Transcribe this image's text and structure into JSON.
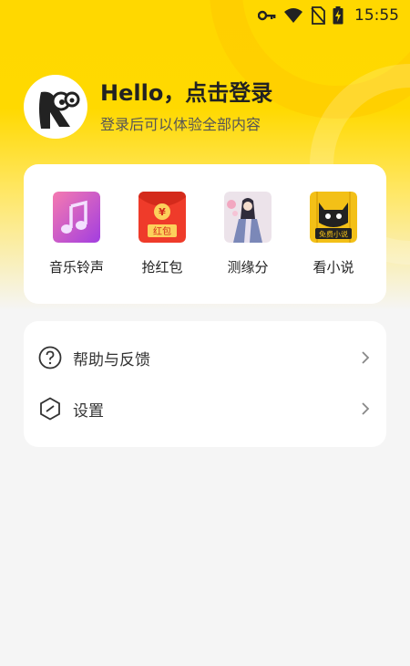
{
  "status_bar": {
    "time": "15:55",
    "icons": [
      "key-icon",
      "wifi-icon",
      "no-sim-icon",
      "battery-charging-icon"
    ]
  },
  "profile": {
    "avatar_icon": "cartoon-mascot-avatar",
    "title": "Hello，点击登录",
    "subtitle": "登录后可以体验全部内容"
  },
  "features": [
    {
      "label": "音乐铃声",
      "icon": "music-note-icon",
      "color": "#c24bd6"
    },
    {
      "label": "抢红包",
      "icon": "red-envelope-icon",
      "color": "#e53b24",
      "icon_text": "红包",
      "icon_symbol": "¥"
    },
    {
      "label": "测缘分",
      "icon": "couple-illustration-icon",
      "color": "#e7dbe6"
    },
    {
      "label": "看小说",
      "icon": "cat-novel-icon",
      "color": "#f3c017",
      "icon_text": "免费小说"
    }
  ],
  "menu": [
    {
      "label": "帮助与反馈",
      "icon": "help-circle-icon"
    },
    {
      "label": "设置",
      "icon": "settings-hexagon-icon"
    }
  ],
  "colors": {
    "brand_yellow": "#ffd800",
    "card_bg": "#ffffff",
    "page_bg": "#f5f5f5",
    "text_primary": "#222222"
  }
}
